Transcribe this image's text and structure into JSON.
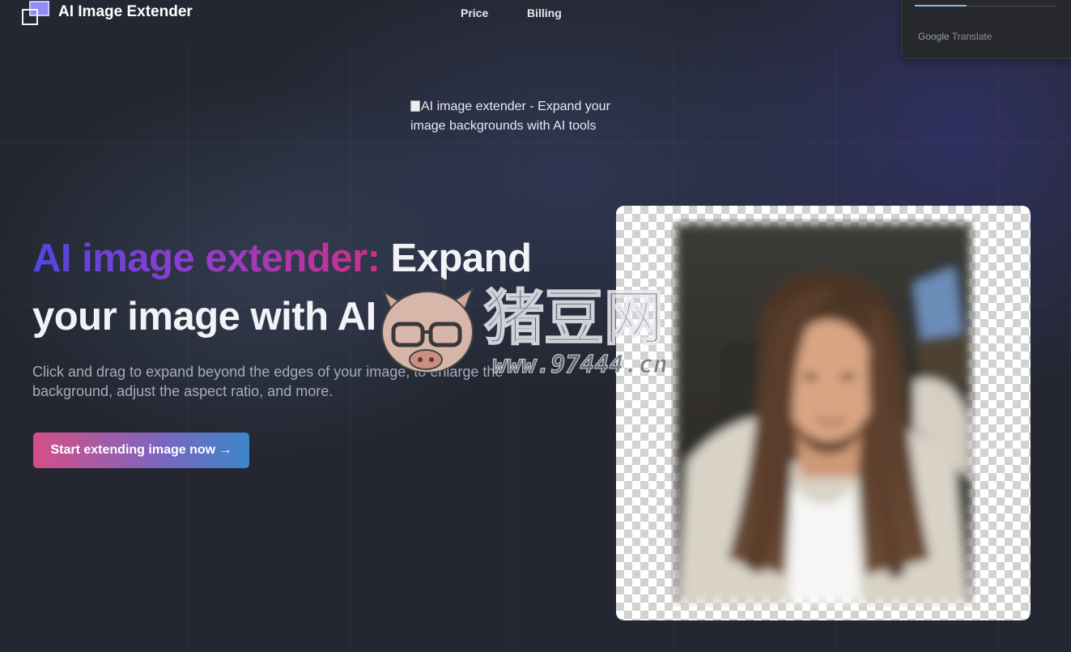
{
  "header": {
    "brand": "AI Image Extender",
    "nav": [
      {
        "label": "Price"
      },
      {
        "label": "Billing"
      }
    ]
  },
  "translate_widget": {
    "label_google": "Google",
    "label_translate": "Translate"
  },
  "broken_image": {
    "alt": "AI image extender - Expand your image backgrounds with AI tools"
  },
  "hero": {
    "title_gradient": "AI image extender:",
    "title_line1_rest": " Expand",
    "title_line2": "your image with AI",
    "subtitle": "Click and drag to expand beyond the edges of your image, to enlarge the background, adjust the aspect ratio, and more.",
    "cta_label": "Start extending image now →"
  },
  "watermark": {
    "text": "猪豆网",
    "domain": "www.97444.cn"
  },
  "colors": {
    "background": "#242731",
    "gradient_title_start": "#5146e0",
    "gradient_title_end": "#d02f86",
    "cta_start": "#d64f86",
    "cta_end": "#3c86c9"
  }
}
